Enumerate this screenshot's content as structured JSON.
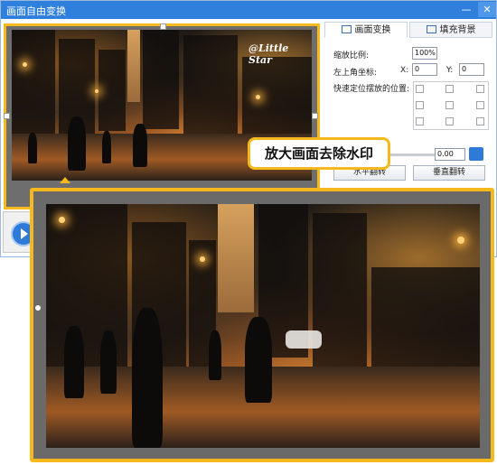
{
  "window": {
    "title": "画面自由变换",
    "minimize_glyph": "—",
    "close_glyph": "✕"
  },
  "preview": {
    "watermark_text": "@Little Star"
  },
  "tabs": [
    {
      "label": "画面变换",
      "icon": "transform-icon",
      "active": true
    },
    {
      "label": "填充背景",
      "icon": "fill-icon",
      "active": false
    }
  ],
  "transform": {
    "scale_label": "缩放比例:",
    "scale_value": "100%",
    "top_left_label": "左上角坐标:",
    "x_label": "X:",
    "x_value": "0",
    "y_label": "Y:",
    "y_value": "0",
    "quick_position_label": "快速定位摆放的位置:",
    "rotation_value": "0.00",
    "flip_h_label": "水平翻转",
    "flip_v_label": "垂直翻转"
  },
  "callout": {
    "text": "放大画面去除水印"
  },
  "colors": {
    "titlebar": "#2f80dc",
    "highlight": "#f5b91e"
  }
}
